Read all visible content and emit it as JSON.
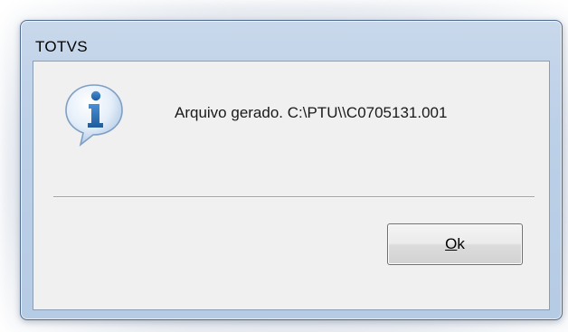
{
  "dialog": {
    "title": "TOTVS",
    "icon": "info-icon",
    "message": "Arquivo gerado. C:\\PTU\\\\C0705131.001",
    "button": {
      "label_accel": "O",
      "label_rest": "k"
    }
  },
  "colors": {
    "frame": "#bcd0e8",
    "client_bg": "#f0f0f0",
    "icon_blue": "#2f6fb3",
    "text": "#1a1a1a"
  }
}
